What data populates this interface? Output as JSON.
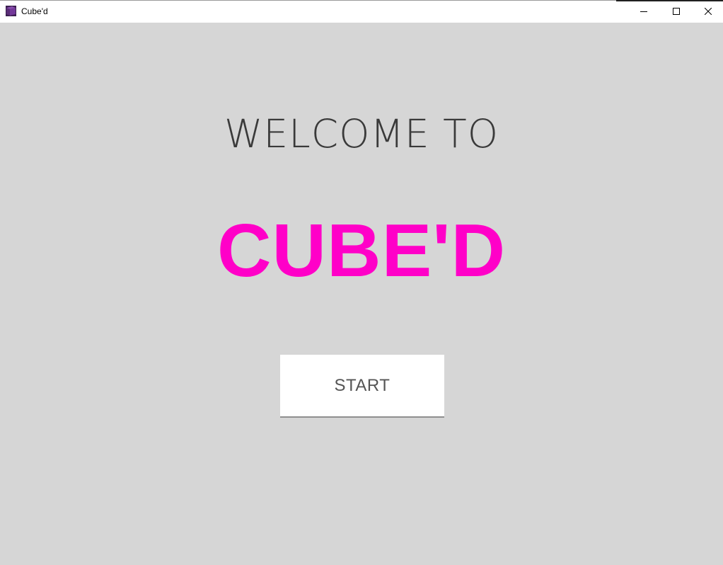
{
  "window": {
    "title": "Cube'd",
    "icon": "cube-app-icon",
    "controls": {
      "minimize_icon": "minimize-icon",
      "maximize_icon": "maximize-icon",
      "close_icon": "close-icon"
    }
  },
  "main": {
    "welcome_text": "WELCOME TO",
    "brand_text": "CUBE'D",
    "start_label": "START"
  },
  "colors": {
    "background": "#d6d6d6",
    "brand": "#ff00c8",
    "welcome_text": "#3a3a3a",
    "button_bg": "#ffffff",
    "button_text": "#555555"
  }
}
